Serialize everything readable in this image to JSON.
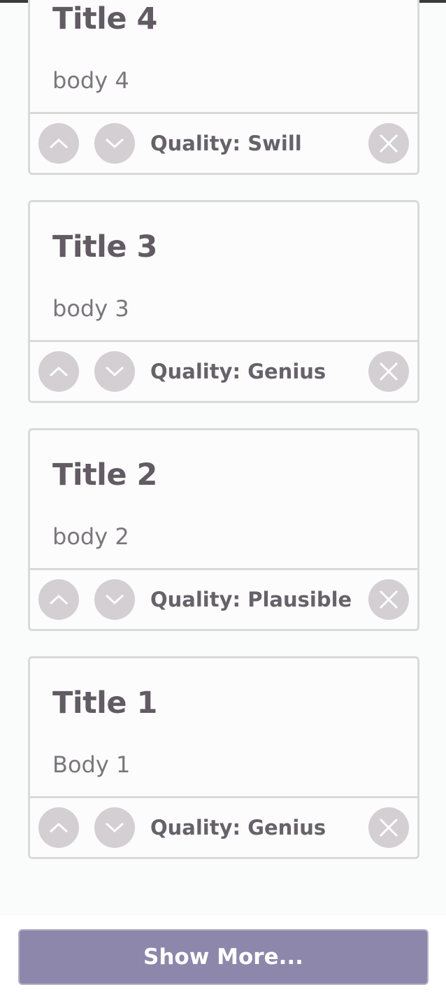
{
  "ideas": [
    {
      "title": "Title 4",
      "body": "body 4",
      "quality": "Quality: Swill"
    },
    {
      "title": "Title 3",
      "body": "body 3",
      "quality": "Quality: Genius"
    },
    {
      "title": "Title 2",
      "body": "body 2",
      "quality": "Quality: Plausible"
    },
    {
      "title": "Title 1",
      "body": "Body 1",
      "quality": "Quality: Genius"
    }
  ],
  "icons": {
    "upvote": "chevron-up-icon",
    "downvote": "chevron-down-icon",
    "delete": "close-icon"
  },
  "show_more_label": "Show More...",
  "colors": {
    "button_accent": "#8c87ab",
    "icon_circle": "#d3cfd2",
    "title_text": "#625b63"
  }
}
